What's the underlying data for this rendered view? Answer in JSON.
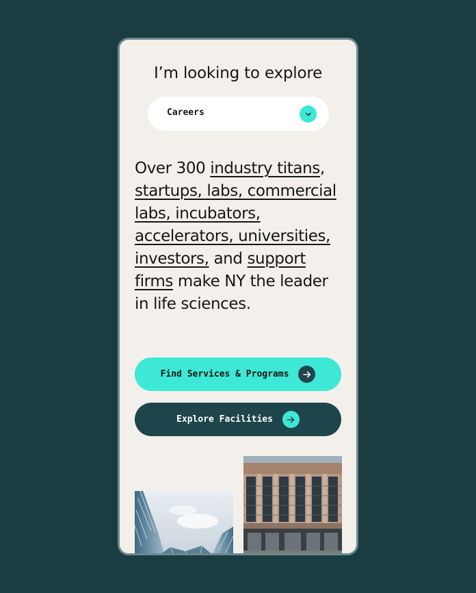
{
  "heading": "I’m looking to explore",
  "select": {
    "value": "Careers",
    "icon": "chevron-down-icon"
  },
  "paragraph": {
    "t1": "Over 300 ",
    "l1": "industry titans",
    "t2": ", ",
    "l2": "startups, labs, commercial labs, incubators, accelerators, universities, investors,",
    "t3": " and ",
    "l3": "support firms",
    "t4": " make NY the leader in life sciences."
  },
  "buttons": {
    "primary": "Find Services & Programs",
    "secondary": "Explore Facilities"
  },
  "colors": {
    "page_bg": "#1a3d42",
    "card_bg": "#f3f0eb",
    "accent": "#3de8d6",
    "dark": "#1f454c"
  }
}
